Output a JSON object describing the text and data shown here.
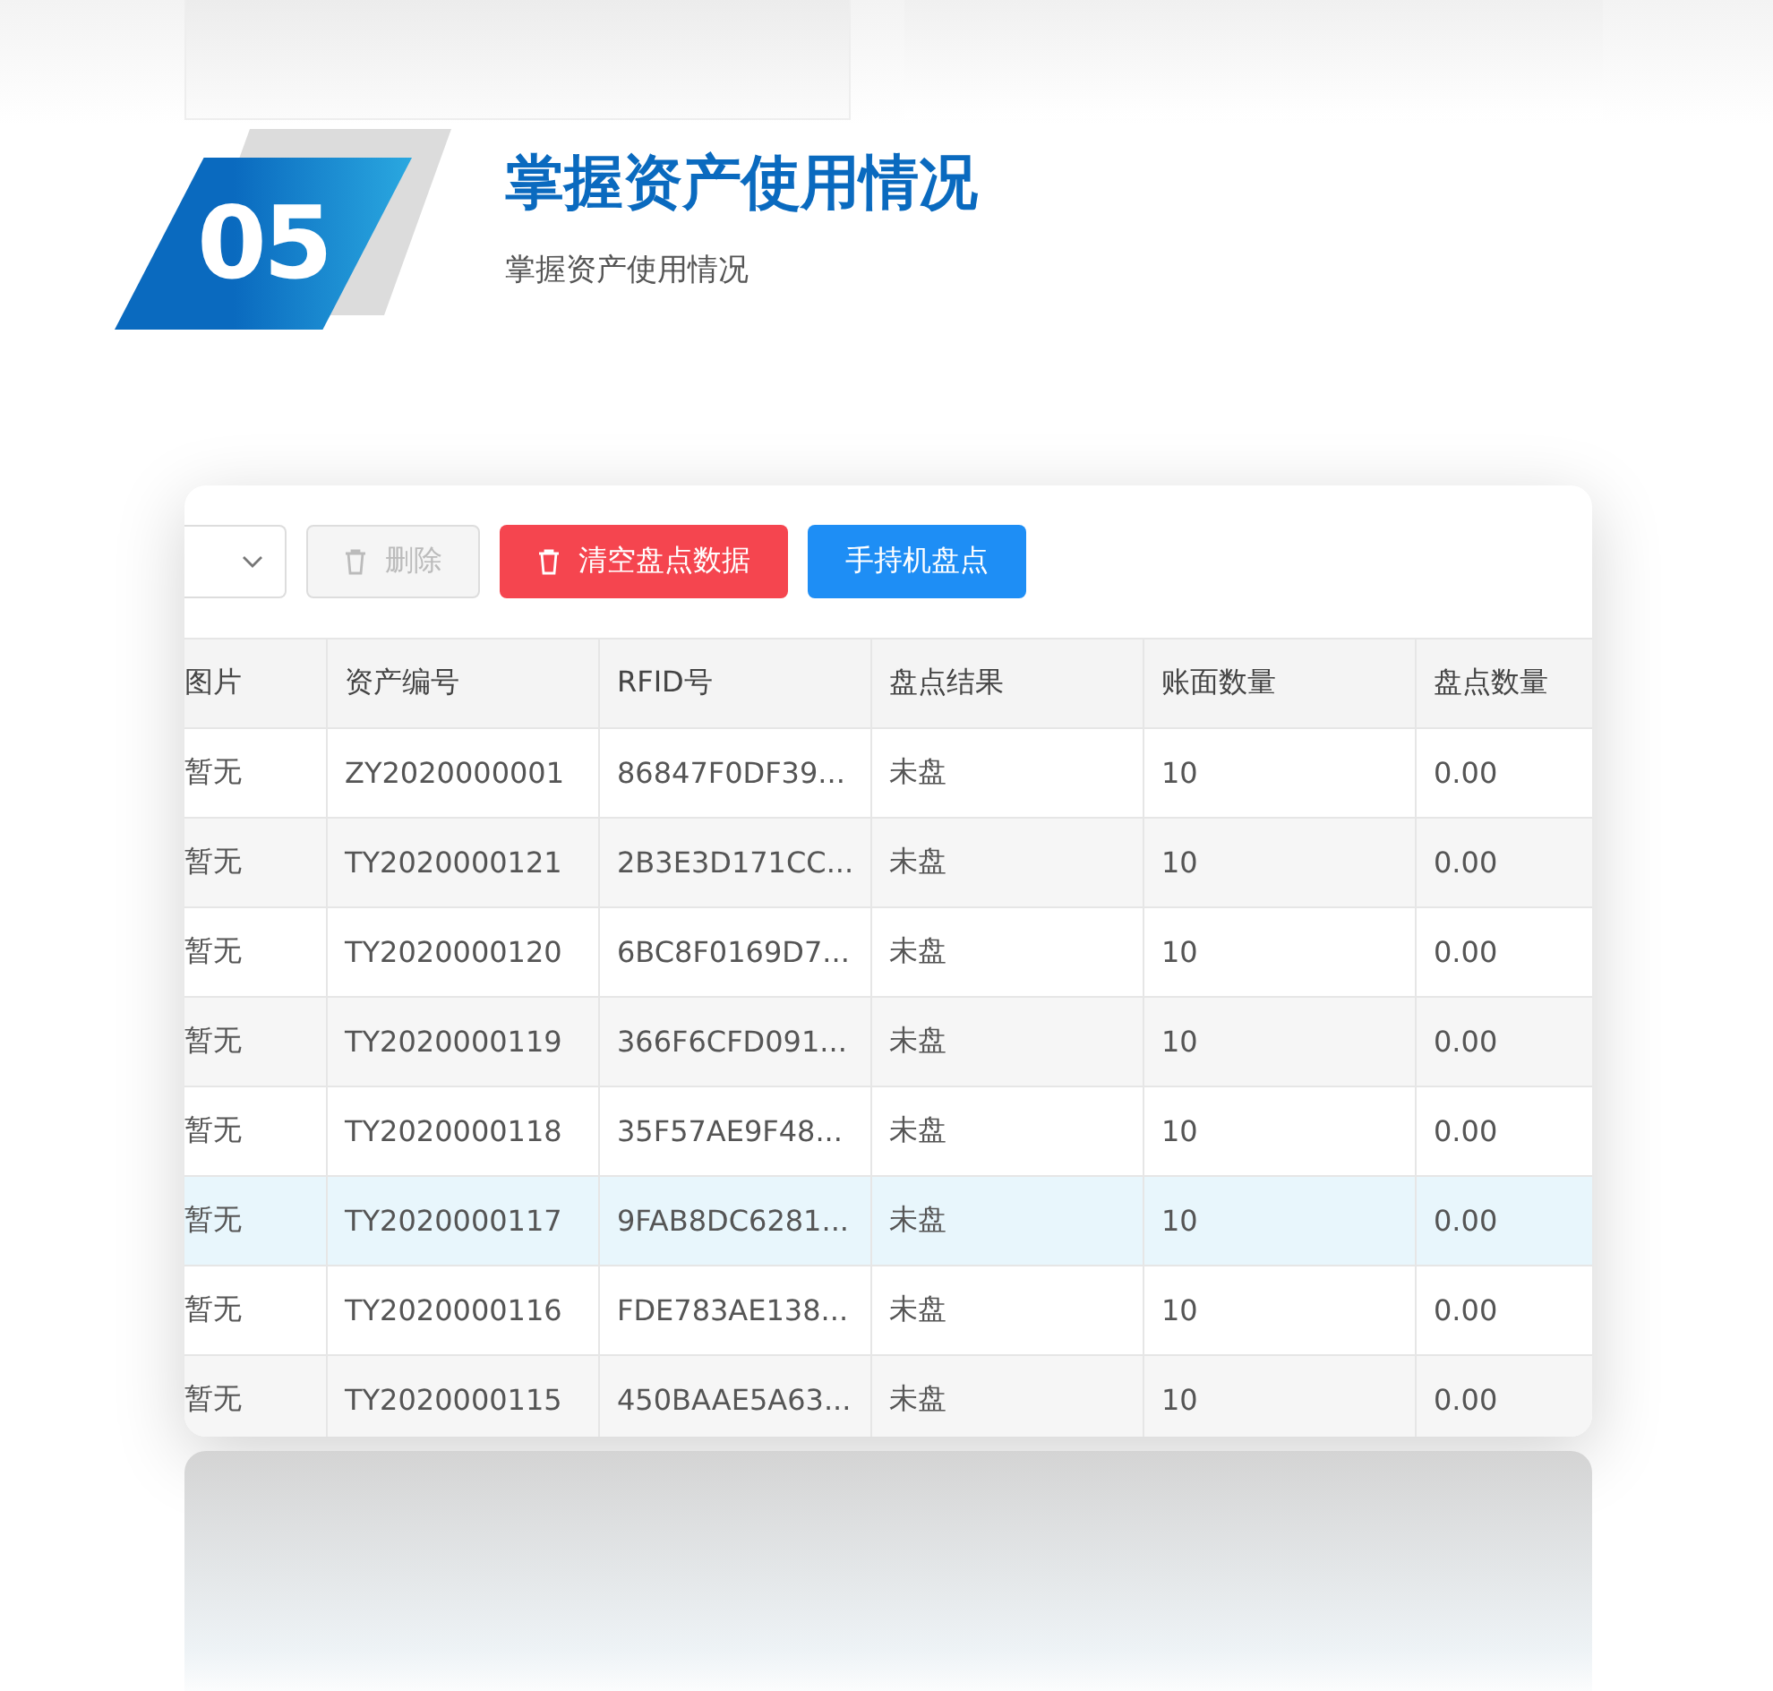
{
  "section": {
    "number": "05",
    "title": "掌握资产使用情况",
    "subtitle": "掌握资产使用情况"
  },
  "toolbar": {
    "buttons": [
      {
        "kind": "dropdown"
      },
      {
        "kind": "delete",
        "label": "删除",
        "disabled": true
      },
      {
        "kind": "danger",
        "label": "清空盘点数据"
      },
      {
        "kind": "primary",
        "label": "手持机盘点"
      }
    ]
  },
  "table": {
    "columns": [
      "图片",
      "资产编号",
      "RFID号",
      "盘点结果",
      "账面数量",
      "盘点数量"
    ],
    "rows": [
      {
        "cells": [
          "暂无",
          "ZY2020000001",
          "86847F0DF39...",
          "未盘",
          "10",
          "0.00"
        ],
        "selected": false
      },
      {
        "cells": [
          "暂无",
          "TY2020000121",
          "2B3E3D171CC...",
          "未盘",
          "10",
          "0.00"
        ],
        "selected": false
      },
      {
        "cells": [
          "暂无",
          "TY2020000120",
          "6BC8F0169D7...",
          "未盘",
          "10",
          "0.00"
        ],
        "selected": false
      },
      {
        "cells": [
          "暂无",
          "TY2020000119",
          "366F6CFD091...",
          "未盘",
          "10",
          "0.00"
        ],
        "selected": false
      },
      {
        "cells": [
          "暂无",
          "TY2020000118",
          "35F57AE9F48...",
          "未盘",
          "10",
          "0.00"
        ],
        "selected": false
      },
      {
        "cells": [
          "暂无",
          "TY2020000117",
          "9FAB8DC6281...",
          "未盘",
          "10",
          "0.00"
        ],
        "selected": true
      },
      {
        "cells": [
          "暂无",
          "TY2020000116",
          "FDE783AE138...",
          "未盘",
          "10",
          "0.00"
        ],
        "selected": false
      },
      {
        "cells": [
          "暂无",
          "TY2020000115",
          "450BAAE5A63...",
          "未盘",
          "10",
          "0.00"
        ],
        "selected": false
      }
    ]
  }
}
